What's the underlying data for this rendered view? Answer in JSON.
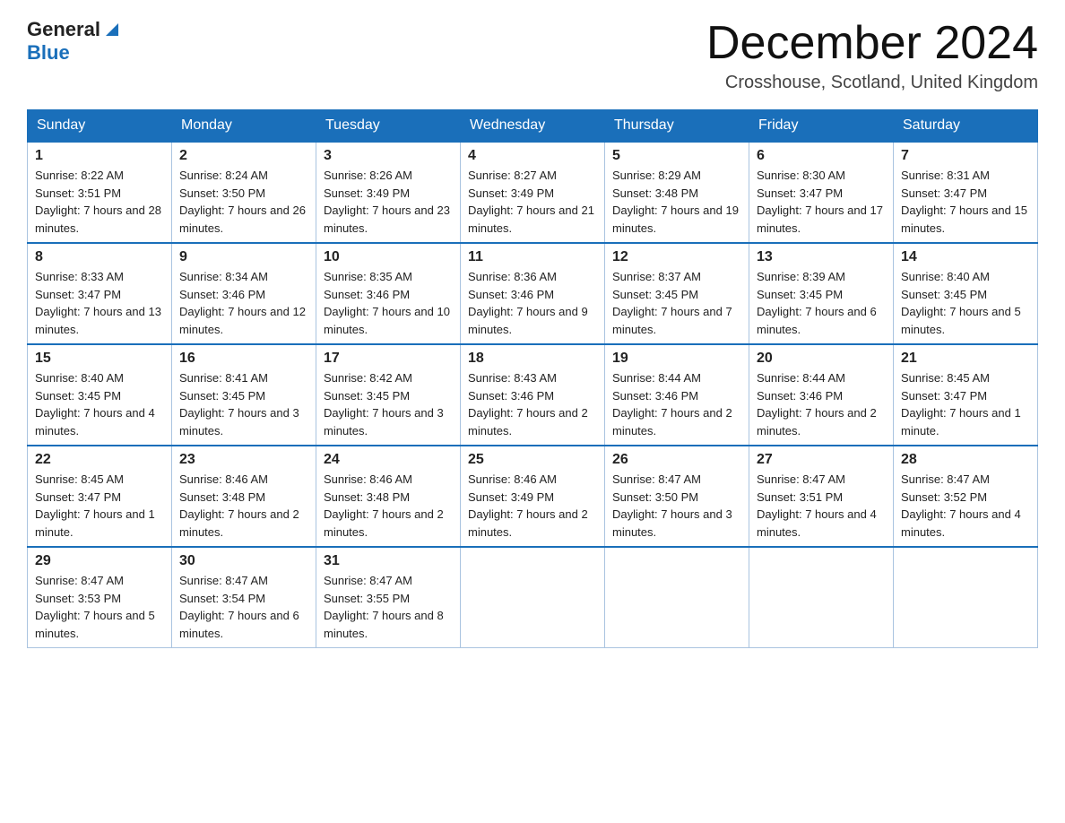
{
  "header": {
    "logo_general": "General",
    "logo_blue": "Blue",
    "month_title": "December 2024",
    "location": "Crosshouse, Scotland, United Kingdom"
  },
  "days_of_week": [
    "Sunday",
    "Monday",
    "Tuesday",
    "Wednesday",
    "Thursday",
    "Friday",
    "Saturday"
  ],
  "weeks": [
    [
      {
        "day": "1",
        "sunrise": "8:22 AM",
        "sunset": "3:51 PM",
        "daylight": "7 hours and 28 minutes."
      },
      {
        "day": "2",
        "sunrise": "8:24 AM",
        "sunset": "3:50 PM",
        "daylight": "7 hours and 26 minutes."
      },
      {
        "day": "3",
        "sunrise": "8:26 AM",
        "sunset": "3:49 PM",
        "daylight": "7 hours and 23 minutes."
      },
      {
        "day": "4",
        "sunrise": "8:27 AM",
        "sunset": "3:49 PM",
        "daylight": "7 hours and 21 minutes."
      },
      {
        "day": "5",
        "sunrise": "8:29 AM",
        "sunset": "3:48 PM",
        "daylight": "7 hours and 19 minutes."
      },
      {
        "day": "6",
        "sunrise": "8:30 AM",
        "sunset": "3:47 PM",
        "daylight": "7 hours and 17 minutes."
      },
      {
        "day": "7",
        "sunrise": "8:31 AM",
        "sunset": "3:47 PM",
        "daylight": "7 hours and 15 minutes."
      }
    ],
    [
      {
        "day": "8",
        "sunrise": "8:33 AM",
        "sunset": "3:47 PM",
        "daylight": "7 hours and 13 minutes."
      },
      {
        "day": "9",
        "sunrise": "8:34 AM",
        "sunset": "3:46 PM",
        "daylight": "7 hours and 12 minutes."
      },
      {
        "day": "10",
        "sunrise": "8:35 AM",
        "sunset": "3:46 PM",
        "daylight": "7 hours and 10 minutes."
      },
      {
        "day": "11",
        "sunrise": "8:36 AM",
        "sunset": "3:46 PM",
        "daylight": "7 hours and 9 minutes."
      },
      {
        "day": "12",
        "sunrise": "8:37 AM",
        "sunset": "3:45 PM",
        "daylight": "7 hours and 7 minutes."
      },
      {
        "day": "13",
        "sunrise": "8:39 AM",
        "sunset": "3:45 PM",
        "daylight": "7 hours and 6 minutes."
      },
      {
        "day": "14",
        "sunrise": "8:40 AM",
        "sunset": "3:45 PM",
        "daylight": "7 hours and 5 minutes."
      }
    ],
    [
      {
        "day": "15",
        "sunrise": "8:40 AM",
        "sunset": "3:45 PM",
        "daylight": "7 hours and 4 minutes."
      },
      {
        "day": "16",
        "sunrise": "8:41 AM",
        "sunset": "3:45 PM",
        "daylight": "7 hours and 3 minutes."
      },
      {
        "day": "17",
        "sunrise": "8:42 AM",
        "sunset": "3:45 PM",
        "daylight": "7 hours and 3 minutes."
      },
      {
        "day": "18",
        "sunrise": "8:43 AM",
        "sunset": "3:46 PM",
        "daylight": "7 hours and 2 minutes."
      },
      {
        "day": "19",
        "sunrise": "8:44 AM",
        "sunset": "3:46 PM",
        "daylight": "7 hours and 2 minutes."
      },
      {
        "day": "20",
        "sunrise": "8:44 AM",
        "sunset": "3:46 PM",
        "daylight": "7 hours and 2 minutes."
      },
      {
        "day": "21",
        "sunrise": "8:45 AM",
        "sunset": "3:47 PM",
        "daylight": "7 hours and 1 minute."
      }
    ],
    [
      {
        "day": "22",
        "sunrise": "8:45 AM",
        "sunset": "3:47 PM",
        "daylight": "7 hours and 1 minute."
      },
      {
        "day": "23",
        "sunrise": "8:46 AM",
        "sunset": "3:48 PM",
        "daylight": "7 hours and 2 minutes."
      },
      {
        "day": "24",
        "sunrise": "8:46 AM",
        "sunset": "3:48 PM",
        "daylight": "7 hours and 2 minutes."
      },
      {
        "day": "25",
        "sunrise": "8:46 AM",
        "sunset": "3:49 PM",
        "daylight": "7 hours and 2 minutes."
      },
      {
        "day": "26",
        "sunrise": "8:47 AM",
        "sunset": "3:50 PM",
        "daylight": "7 hours and 3 minutes."
      },
      {
        "day": "27",
        "sunrise": "8:47 AM",
        "sunset": "3:51 PM",
        "daylight": "7 hours and 4 minutes."
      },
      {
        "day": "28",
        "sunrise": "8:47 AM",
        "sunset": "3:52 PM",
        "daylight": "7 hours and 4 minutes."
      }
    ],
    [
      {
        "day": "29",
        "sunrise": "8:47 AM",
        "sunset": "3:53 PM",
        "daylight": "7 hours and 5 minutes."
      },
      {
        "day": "30",
        "sunrise": "8:47 AM",
        "sunset": "3:54 PM",
        "daylight": "7 hours and 6 minutes."
      },
      {
        "day": "31",
        "sunrise": "8:47 AM",
        "sunset": "3:55 PM",
        "daylight": "7 hours and 8 minutes."
      },
      null,
      null,
      null,
      null
    ]
  ],
  "labels": {
    "sunrise": "Sunrise:",
    "sunset": "Sunset:",
    "daylight": "Daylight:"
  }
}
